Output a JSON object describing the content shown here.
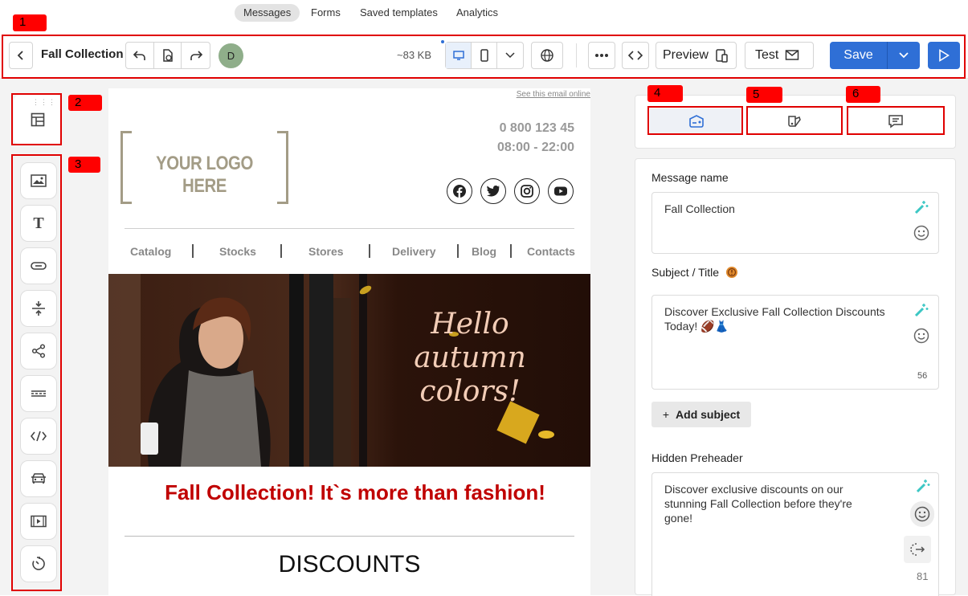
{
  "top_nav": {
    "items": [
      "Messages",
      "Forms",
      "Saved templates",
      "Analytics"
    ],
    "active": "Messages"
  },
  "toolbar": {
    "title": "Fall Collection",
    "avatar_initial": "D",
    "size": "~83 KB",
    "preview_label": "Preview",
    "test_label": "Test",
    "save_label": "Save"
  },
  "annotations": [
    "1",
    "2",
    "3",
    "4",
    "5",
    "6"
  ],
  "left_tools": [
    "image-block-icon",
    "text-block-icon",
    "button-block-icon",
    "spacer-block-icon",
    "social-block-icon",
    "divider-block-icon",
    "html-block-icon",
    "product-block-icon",
    "video-block-icon",
    "timer-block-icon"
  ],
  "email": {
    "see_online": "See this email online",
    "logo_text": "YOUR LOGO HERE",
    "phone": "0 800 123 45",
    "hours": "08:00 - 22:00",
    "nav": [
      "Catalog",
      "Stocks",
      "Stores",
      "Delivery",
      "Blog",
      "Contacts"
    ],
    "hero_text_lines": [
      "Hello",
      "autumn",
      "colors!"
    ],
    "headline": "Fall Collection! It`s more than fashion!",
    "section_title": "DISCOUNTS"
  },
  "settings": {
    "message_name_label": "Message name",
    "message_name_value": "Fall Collection",
    "subject_label": "Subject / Title",
    "subject_value": "Discover Exclusive Fall Collection Discounts Today! 🏈👗",
    "subject_count": "56",
    "add_subject_label": "Add subject",
    "preheader_label": "Hidden Preheader",
    "preheader_value": "Discover exclusive discounts on our stunning Fall Collection before they're gone!",
    "preheader_count": "81"
  },
  "colors": {
    "accent_blue": "#2f6fd6",
    "annotation_red": "#ff0000",
    "headline_red": "#c00000",
    "hero_bg": "#2a1208",
    "hero_text": "#f3cdb7"
  }
}
